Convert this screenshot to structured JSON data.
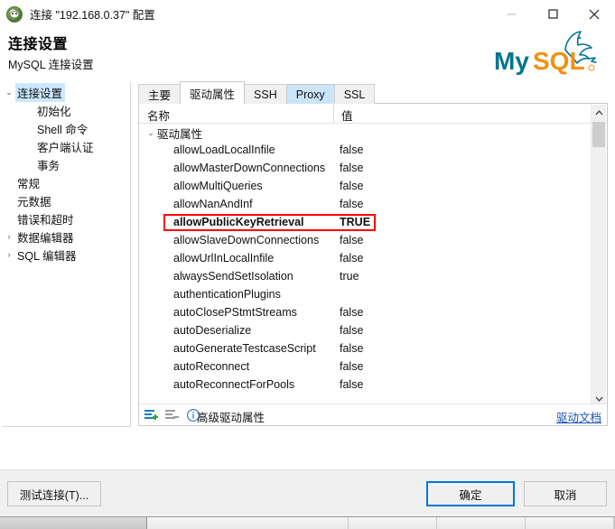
{
  "window": {
    "title": "连接 \"192.168.0.37\" 配置",
    "icon": "dbeaver-icon",
    "controls": {
      "minimize": "minimize-icon",
      "maximize": "maximize-icon",
      "close": "close-icon"
    }
  },
  "header": {
    "title": "连接设置",
    "subtitle": "MySQL 连接设置",
    "logo_text_1": "My",
    "logo_text_2": "SQL",
    "logo_colors": {
      "teal": "#00758f",
      "orange": "#f29111"
    }
  },
  "sidebar": {
    "items": [
      {
        "label": "连接设置",
        "level": 0,
        "twisty": "⌄",
        "selected": true
      },
      {
        "label": "初始化",
        "level": 1,
        "twisty": "",
        "selected": false
      },
      {
        "label": "Shell 命令",
        "level": 1,
        "twisty": "",
        "selected": false
      },
      {
        "label": "客户端认证",
        "level": 1,
        "twisty": "",
        "selected": false
      },
      {
        "label": "事务",
        "level": 1,
        "twisty": "",
        "selected": false
      },
      {
        "label": "常规",
        "level": 0,
        "twisty": "",
        "selected": false
      },
      {
        "label": "元数据",
        "level": 0,
        "twisty": "",
        "selected": false
      },
      {
        "label": "错误和超时",
        "level": 0,
        "twisty": "",
        "selected": false
      },
      {
        "label": "数据编辑器",
        "level": 0,
        "twisty": "›",
        "selected": false
      },
      {
        "label": "SQL 编辑器",
        "level": 0,
        "twisty": "›",
        "selected": false
      }
    ]
  },
  "tabs": [
    {
      "label": "主要",
      "state": "normal"
    },
    {
      "label": "驱动属性",
      "state": "active"
    },
    {
      "label": "SSH",
      "state": "normal"
    },
    {
      "label": "Proxy",
      "state": "hover"
    },
    {
      "label": "SSL",
      "state": "normal"
    }
  ],
  "table": {
    "columns": {
      "name": "名称",
      "value": "值"
    },
    "group": {
      "label": "驱动属性",
      "twisty": "⌄"
    },
    "rows": [
      {
        "name": "allowLoadLocalInfile",
        "value": "false",
        "highlight": false
      },
      {
        "name": "allowMasterDownConnections",
        "value": "false",
        "highlight": false
      },
      {
        "name": "allowMultiQueries",
        "value": "false",
        "highlight": false
      },
      {
        "name": "allowNanAndInf",
        "value": "false",
        "highlight": false
      },
      {
        "name": "allowPublicKeyRetrieval",
        "value": "TRUE",
        "highlight": true
      },
      {
        "name": "allowSlaveDownConnections",
        "value": "false",
        "highlight": false
      },
      {
        "name": "allowUrlInLocalInfile",
        "value": "false",
        "highlight": false
      },
      {
        "name": "alwaysSendSetIsolation",
        "value": "true",
        "highlight": false
      },
      {
        "name": "authenticationPlugins",
        "value": "",
        "highlight": false
      },
      {
        "name": "autoClosePStmtStreams",
        "value": "false",
        "highlight": false
      },
      {
        "name": "autoDeserialize",
        "value": "false",
        "highlight": false
      },
      {
        "name": "autoGenerateTestcaseScript",
        "value": "false",
        "highlight": false
      },
      {
        "name": "autoReconnect",
        "value": "false",
        "highlight": false
      },
      {
        "name": "autoReconnectForPools",
        "value": "false",
        "highlight": false
      }
    ],
    "highlight_color": "#ff0000"
  },
  "panel_toolbar": {
    "add_icon": "add-rows-icon",
    "remove_icon": "remove-rows-icon",
    "info_icon": "info-circle-icon",
    "advanced_label": "高级驱动属性",
    "doc_link": "驱动文档",
    "link_color": "#1a4fb4"
  },
  "footer": {
    "test_label": "测试连接(T)...",
    "ok_label": "确定",
    "cancel_label": "取消",
    "focus_color": "#0078d7"
  },
  "scrollbar": {
    "up_arrow": "chevron-up-icon",
    "down_arrow": "chevron-down-icon"
  }
}
